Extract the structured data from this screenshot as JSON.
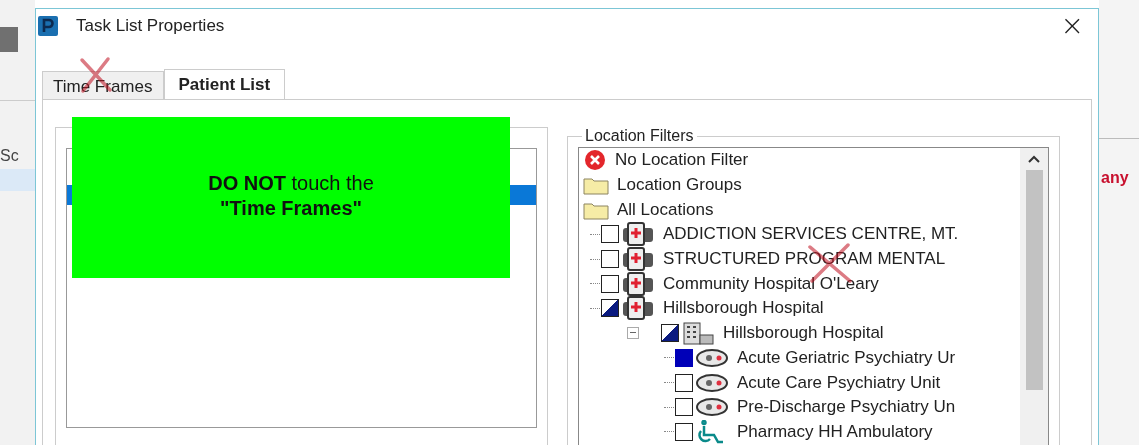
{
  "background": {
    "left_text": "Sc",
    "right_text": "any"
  },
  "window": {
    "title": "Task List Properties",
    "close": "×"
  },
  "tabs": [
    {
      "label": "Time Frames",
      "selected": false
    },
    {
      "label": "Patient List",
      "selected": true
    }
  ],
  "left_panel": {
    "rows": [
      {
        "selected": true
      }
    ]
  },
  "note": {
    "line_1": "**DO NOT** touch the",
    "line_2": "\"Time Frames\""
  },
  "location_filters": {
    "title": "Location Filters",
    "tree": [
      {
        "kind": "no-filter",
        "label": "No Location Filter"
      },
      {
        "kind": "folder",
        "label": "Location Groups"
      },
      {
        "kind": "folder",
        "label": "All Locations",
        "children": [
          {
            "kind": "hospital",
            "label": "ADDICTION SERVICES CENTRE, MT.",
            "checked": false,
            "partial": false
          },
          {
            "kind": "hospital",
            "label": "STRUCTURED PROGRAM MENTAL",
            "checked": false,
            "partial": false
          },
          {
            "kind": "hospital",
            "label": "Community Hospital O'Leary",
            "checked": false,
            "partial": false
          },
          {
            "kind": "hospital",
            "label": "Hillsborough Hospital",
            "checked": true,
            "partial": true,
            "children": [
              {
                "kind": "building",
                "label": "Hillsborough Hospital",
                "checked": true,
                "partial": true,
                "expanded": true,
                "children": [
                  {
                    "kind": "unit",
                    "label": "Acute Geriatric Psychiatry Ur",
                    "checked": true,
                    "partial": false
                  },
                  {
                    "kind": "unit",
                    "label": "Acute Care Psychiatry Unit",
                    "checked": false,
                    "partial": false
                  },
                  {
                    "kind": "unit",
                    "label": "Pre-Discharge Psychiatry Un",
                    "checked": false,
                    "partial": false
                  },
                  {
                    "kind": "wheelchair",
                    "label": "Pharmacy HH Ambulatory",
                    "checked": false,
                    "partial": false
                  }
                ]
              }
            ]
          }
        ]
      }
    ]
  }
}
